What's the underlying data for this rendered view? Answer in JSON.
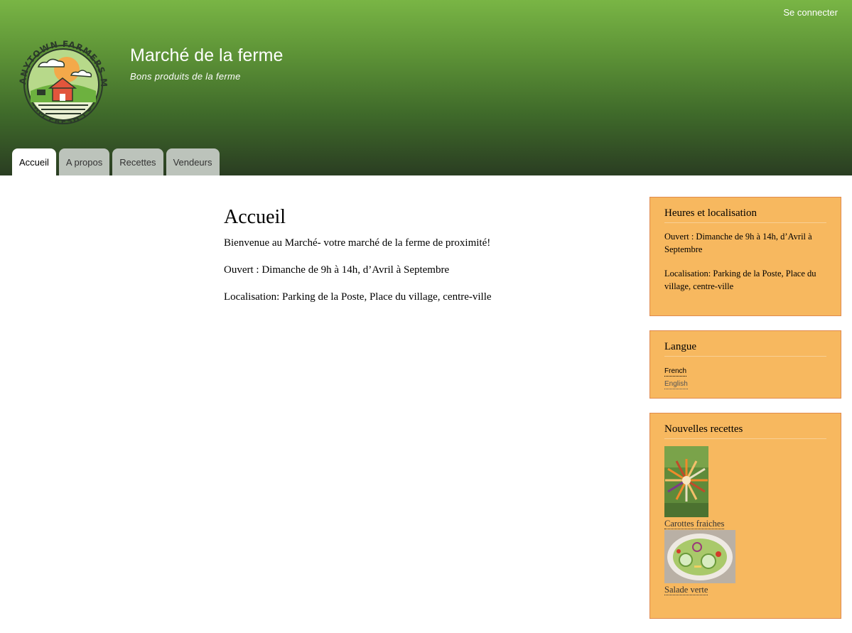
{
  "header": {
    "login_label": "Se connecter",
    "site_name": "Marché de la ferme",
    "slogan": "Bons produits de la ferme",
    "logo_alt": "Anytown Farmers Market Farm Fresh Food logo",
    "logo_text_top": "ANYTOWN FARMERS MARKET",
    "logo_text_bottom": "FARM FRESH FOOD"
  },
  "tabs": [
    {
      "label": "Accueil",
      "active": true
    },
    {
      "label": "A propos",
      "active": false
    },
    {
      "label": "Recettes",
      "active": false
    },
    {
      "label": "Vendeurs",
      "active": false
    }
  ],
  "main": {
    "title": "Accueil",
    "paragraphs": [
      "Bienvenue au Marché- votre marché de la ferme de proximité!",
      "Ouvert : Dimanche de 9h à 14h, d’Avril à Septembre",
      "Localisation: Parking de la Poste, Place du village, centre-ville"
    ]
  },
  "sidebar": {
    "hours": {
      "title": "Heures et localisation",
      "open": "Ouvert : Dimanche de 9h à 14h, d’Avril à Septembre",
      "location": "Localisation: Parking de la Poste, Place du village, centre-ville"
    },
    "language": {
      "title": "Langue",
      "options": [
        "French",
        "English"
      ]
    },
    "recipes": {
      "title": "Nouvelles recettes",
      "items": [
        {
          "label": "Carottes fraiches"
        },
        {
          "label": "Salade verte"
        }
      ]
    }
  },
  "colors": {
    "header_top": "#79b545",
    "header_bottom": "#2a3d22",
    "tab_inactive": "#bcc3bb",
    "sidebar_block": "#f7b85f",
    "sidebar_border": "#e08a4e"
  }
}
